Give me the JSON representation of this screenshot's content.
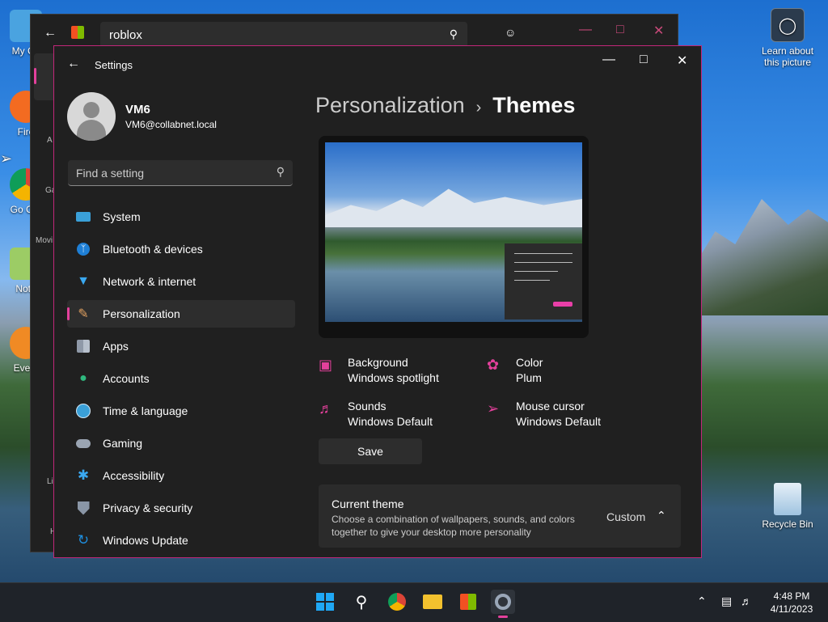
{
  "desktop": {
    "icons": [
      {
        "label": "My Co"
      },
      {
        "label": "Fire"
      },
      {
        "label": "Go Chr"
      },
      {
        "label": "Note"
      },
      {
        "label": "Every"
      }
    ],
    "learn": {
      "line1": "Learn about",
      "line2": "this picture"
    },
    "recycle": {
      "label": "Recycle Bin"
    }
  },
  "store": {
    "search_value": "roblox",
    "side_labels": [
      "A",
      "Ga",
      "Movi",
      "Li",
      "H"
    ]
  },
  "settings": {
    "title": "Settings",
    "user": {
      "name": "VM6",
      "email": "VM6@collabnet.local"
    },
    "search": {
      "placeholder": "Find a setting"
    },
    "nav": [
      {
        "label": "System",
        "icon": "system-icon",
        "color": "#3aa0d8"
      },
      {
        "label": "Bluetooth & devices",
        "icon": "bluetooth-icon",
        "color": "#1e7fd6"
      },
      {
        "label": "Network & internet",
        "icon": "wifi-icon",
        "color": "#3aa8f0"
      },
      {
        "label": "Personalization",
        "icon": "brush-icon",
        "color": "#e0a060"
      },
      {
        "label": "Apps",
        "icon": "apps-icon",
        "color": "#9aa4b2"
      },
      {
        "label": "Accounts",
        "icon": "accounts-icon",
        "color": "#2fb87e"
      },
      {
        "label": "Time & language",
        "icon": "clock-icon",
        "color": "#3aa0d8"
      },
      {
        "label": "Gaming",
        "icon": "controller-icon",
        "color": "#9aa4b2"
      },
      {
        "label": "Accessibility",
        "icon": "accessibility-icon",
        "color": "#3aa8f0"
      },
      {
        "label": "Privacy & security",
        "icon": "shield-icon",
        "color": "#8a96a6"
      },
      {
        "label": "Windows Update",
        "icon": "update-icon",
        "color": "#1e8fe0"
      }
    ],
    "selected_nav": "Personalization",
    "breadcrumb": {
      "parent": "Personalization",
      "current": "Themes"
    },
    "props": {
      "background": {
        "title": "Background",
        "value": "Windows spotlight"
      },
      "color": {
        "title": "Color",
        "value": "Plum"
      },
      "sounds": {
        "title": "Sounds",
        "value": "Windows Default"
      },
      "cursor": {
        "title": "Mouse cursor",
        "value": "Windows Default"
      }
    },
    "save_label": "Save",
    "current_theme": {
      "title": "Current theme",
      "description": "Choose a combination of wallpapers, sounds, and colors together to give your desktop more personality",
      "value": "Custom"
    }
  },
  "taskbar": {
    "time": "4:48 PM",
    "date": "4/11/2023"
  },
  "colors": {
    "accent": "#e3409b"
  }
}
